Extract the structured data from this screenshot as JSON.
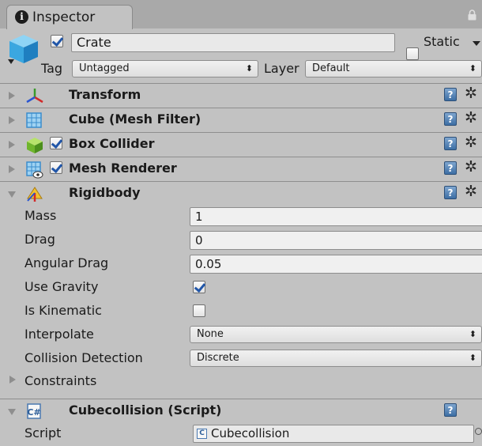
{
  "tab": {
    "title": "Inspector"
  },
  "header": {
    "active": true,
    "name": "Crate",
    "static_label": "Static",
    "static": false,
    "tag_label": "Tag",
    "tag_value": "Untagged",
    "layer_label": "Layer",
    "layer_value": "Default"
  },
  "components": [
    {
      "name": "Transform",
      "icon": "transform-icon",
      "has_toggle": false,
      "expanded": false
    },
    {
      "name": "Cube (Mesh Filter)",
      "icon": "mesh-filter-icon",
      "has_toggle": false,
      "expanded": false
    },
    {
      "name": "Box Collider",
      "icon": "box-collider-icon",
      "has_toggle": true,
      "enabled": true,
      "expanded": false
    },
    {
      "name": "Mesh Renderer",
      "icon": "mesh-renderer-icon",
      "has_toggle": true,
      "enabled": true,
      "expanded": false
    },
    {
      "name": "Rigidbody",
      "icon": "rigidbody-icon",
      "has_toggle": false,
      "expanded": true
    },
    {
      "name": "Cubecollision (Script)",
      "icon": "script-icon",
      "has_toggle": false,
      "expanded": true
    }
  ],
  "rigidbody": {
    "mass_label": "Mass",
    "mass": "1",
    "drag_label": "Drag",
    "drag": "0",
    "angular_drag_label": "Angular Drag",
    "angular_drag": "0.05",
    "use_gravity_label": "Use Gravity",
    "use_gravity": true,
    "is_kinematic_label": "Is Kinematic",
    "is_kinematic": false,
    "interpolate_label": "Interpolate",
    "interpolate": "None",
    "collision_detection_label": "Collision Detection",
    "collision_detection": "Discrete",
    "constraints_label": "Constraints"
  },
  "script_component": {
    "script_label": "Script",
    "script_value": "Cubecollision"
  },
  "glyphs": {
    "help": "?",
    "gear": "✲",
    "dropdown_arrows": "⬍",
    "info": "i",
    "script_mark": "C"
  },
  "colors": {
    "panel": "#c2c2c2",
    "help_blue": "#3d6ea4",
    "check_blue": "#2156a8"
  }
}
